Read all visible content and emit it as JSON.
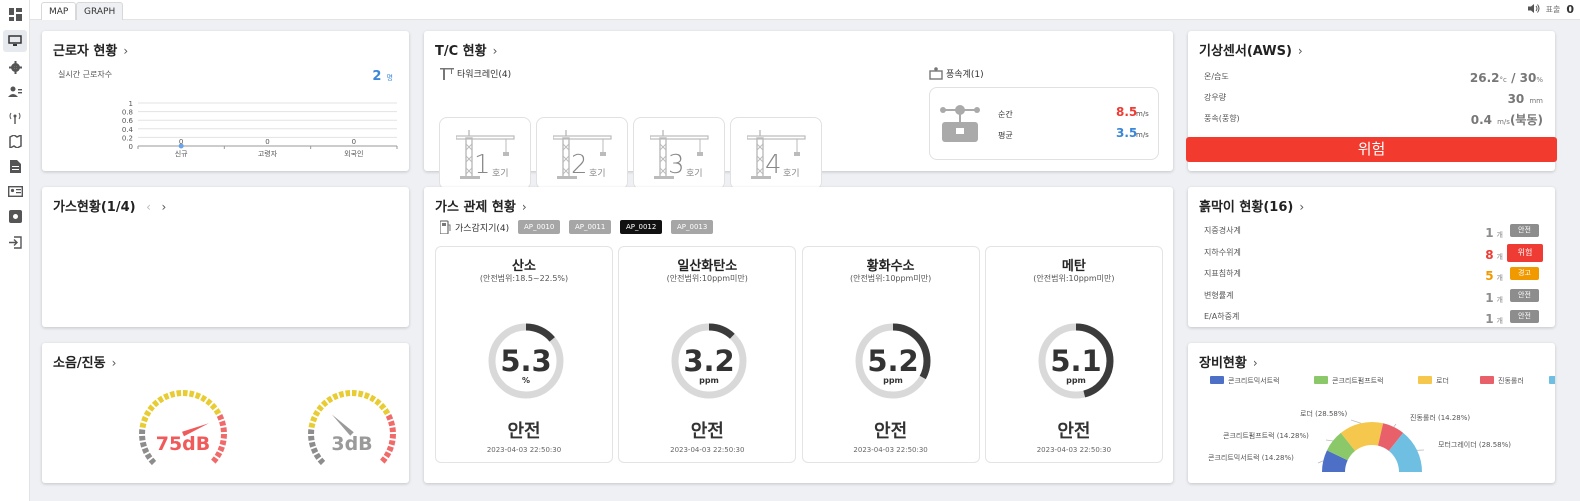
{
  "tabs": [
    {
      "label": "MAP"
    },
    {
      "label": "GRAPH"
    }
  ],
  "topbar": {
    "sound_label": "표출",
    "sound_state": "0"
  },
  "sidebar": {
    "icons": [
      "dashboard-icon",
      "monitor-icon",
      "gear-icon",
      "users-icon",
      "antenna-icon",
      "map-icon",
      "document-icon",
      "id-card-icon",
      "settings-box-icon",
      "logout-icon"
    ]
  },
  "workers": {
    "title": "근로자 현황",
    "subtitle": "실시간 근로자수",
    "count": "2",
    "count_unit": "명",
    "yticks": [
      "1",
      "0.8",
      "0.6",
      "0.4",
      "0.2",
      "0"
    ],
    "chart_labels": [
      "0",
      "0",
      "0"
    ]
  },
  "chart_data": {
    "type": "line",
    "categories": [
      "신규",
      "고령자",
      "외국인"
    ],
    "values": [
      0,
      0,
      0
    ],
    "ylim": [
      0,
      1
    ]
  },
  "tc": {
    "title": "T/C 현황",
    "crane_label": "타워크레인(4)",
    "cranes": [
      {
        "num": "1",
        "unit": "호기"
      },
      {
        "num": "2",
        "unit": "호기"
      },
      {
        "num": "3",
        "unit": "호기"
      },
      {
        "num": "4",
        "unit": "호기"
      }
    ],
    "anemometer_label": "풍속계(1)",
    "instant_label": "순간",
    "instant_value": "8.5",
    "average_label": "평균",
    "average_value": "3.5",
    "unit": "m/s"
  },
  "weather": {
    "title": "기상센서(AWS)",
    "rows": [
      {
        "label": "온/습도",
        "value": "26.2",
        "unit1": "°c",
        "sep": " / ",
        "value2": "30",
        "unit2": "%"
      },
      {
        "label": "강우량",
        "value": "30",
        "unit1": "mm"
      },
      {
        "label": "풍속(풍향)",
        "value": "0.4",
        "unit1": "m/s",
        "value2": "(북동)"
      }
    ],
    "alert": "위험"
  },
  "gas_status": {
    "title": "가스현황(1/4)"
  },
  "noise": {
    "title": "소음/진동",
    "gauges": [
      {
        "value": "75dB",
        "level": 0.75,
        "color": "#f05a5a"
      },
      {
        "value": "3dB",
        "level": 0.33,
        "color": "#9a9a9a"
      }
    ]
  },
  "gas_control": {
    "title": "가스 관제 현황",
    "detector_label": "가스감지기(4)",
    "tags": [
      "AP_0010",
      "AP_0011",
      "AP_0012",
      "AP_0013"
    ],
    "active_tag": 2,
    "items": [
      {
        "name": "산소",
        "range": "(안전범위:18.5~22.5%)",
        "value": "5.3",
        "unit": "%",
        "status": "안전",
        "time": "2023-04-03 22:50:30",
        "level": 0.14
      },
      {
        "name": "일산화탄소",
        "range": "(안전범위:10ppm미만)",
        "value": "3.2",
        "unit": "ppm",
        "status": "안전",
        "time": "2023-04-03 22:50:30",
        "level": 0.12
      },
      {
        "name": "황화수소",
        "range": "(안전범위:10ppm미만)",
        "value": "5.2",
        "unit": "ppm",
        "status": "안전",
        "time": "2023-04-03 22:50:30",
        "level": 0.33
      },
      {
        "name": "메탄",
        "range": "(안전범위:10ppm미만)",
        "value": "5.1",
        "unit": "ppm",
        "status": "안전",
        "time": "2023-04-03 22:50:30",
        "level": 0.46
      }
    ]
  },
  "earth": {
    "title": "흙막이 현황(16)",
    "unit": "개",
    "rows": [
      {
        "label": "지중경사계",
        "count": "1",
        "status": "안전",
        "color": "#8d8d8d",
        "count_color": "#8d8d8d"
      },
      {
        "label": "지하수위계",
        "count": "8",
        "status": "위험",
        "color": "#ee3b34",
        "count_color": "#ee3b34"
      },
      {
        "label": "지표침하계",
        "count": "5",
        "status": "경고",
        "color": "#f09a00",
        "count_color": "#f09a00"
      },
      {
        "label": "변형률계",
        "count": "1",
        "status": "안전",
        "color": "#8d8d8d",
        "count_color": "#8d8d8d"
      },
      {
        "label": "E/A하중계",
        "count": "1",
        "status": "안전",
        "color": "#8d8d8d",
        "count_color": "#8d8d8d"
      }
    ]
  },
  "equipment": {
    "title": "장비현황",
    "legend": [
      {
        "name": "콘크리트믹서트럭",
        "color": "#4d6fc6"
      },
      {
        "name": "콘크리트펌프트럭",
        "color": "#8bc86a"
      },
      {
        "name": "로더",
        "color": "#f5c74c"
      },
      {
        "name": "진동롤러",
        "color": "#e8616a"
      },
      {
        "name": "모터그레이더",
        "color": "#6fbfe3"
      }
    ],
    "slices": [
      {
        "label": "콘크리트믹서트럭 (14.28%)",
        "value": 14.28
      },
      {
        "label": "콘크리트펌프트럭 (14.28%)",
        "value": 14.28
      },
      {
        "label": "로더 (28.58%)",
        "value": 28.58
      },
      {
        "label": "진동롤러 (14.28%)",
        "value": 14.28
      },
      {
        "label": "모터그레이더 (28.58%)",
        "value": 28.58
      }
    ]
  }
}
